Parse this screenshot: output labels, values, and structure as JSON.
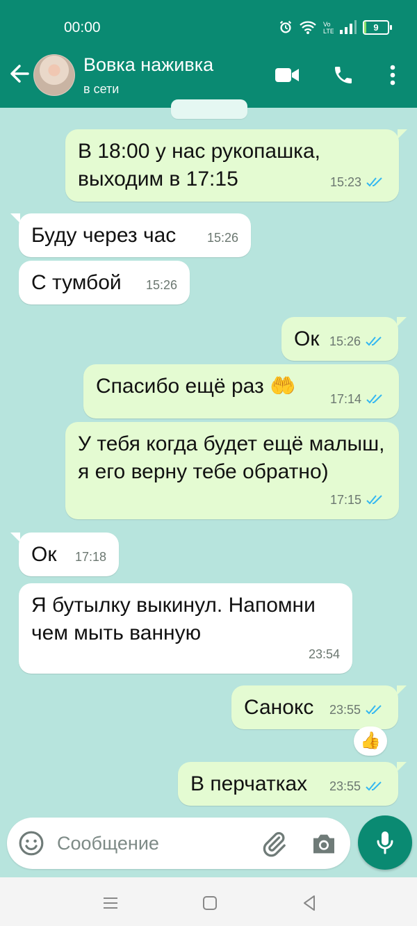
{
  "status_bar": {
    "time": "00:00",
    "battery": "9",
    "battery_fraction": 0.09
  },
  "header": {
    "name": "Вовка наживка",
    "status": "в сети"
  },
  "messages": [
    {
      "dir": "out",
      "text": "В 18:00 у нас рукопашка, выходим в 17:15",
      "time": "15:23",
      "read": true
    },
    {
      "dir": "in",
      "text": "Буду через час",
      "time": "15:26"
    },
    {
      "dir": "in",
      "text": "С тумбой",
      "time": "15:26"
    },
    {
      "dir": "out",
      "text": "Ок",
      "time": "15:26",
      "read": true
    },
    {
      "dir": "out",
      "text": "Спасибо ещё раз 🤲",
      "time": "17:14",
      "read": true
    },
    {
      "dir": "out",
      "text": "У тебя когда будет ещё малыш, я его верну тебе обратно)",
      "time": "17:15",
      "read": true
    },
    {
      "dir": "in",
      "text": "Ок",
      "time": "17:18"
    },
    {
      "dir": "in",
      "text": "Я бутылку выкинул. Напомни чем мыть ванную",
      "time": "23:54"
    },
    {
      "dir": "out",
      "text": "Санокс",
      "time": "23:55",
      "read": true,
      "reaction": "👍"
    },
    {
      "dir": "out",
      "text": "В перчатках",
      "time": "23:55",
      "read": true
    }
  ],
  "composer": {
    "placeholder": "Сообщение"
  },
  "colors": {
    "header": "#0a8a72",
    "chat_bg": "#b7e4dd",
    "outgoing": "#e4fbd2",
    "incoming": "#ffffff",
    "tick": "#34b7f1"
  },
  "icons": [
    "back-arrow-icon",
    "video-call-icon",
    "phone-icon",
    "more-vert-icon",
    "emoji-icon",
    "attach-icon",
    "camera-icon",
    "mic-icon",
    "alarm-icon",
    "wifi-icon",
    "signal-icon",
    "battery-icon"
  ]
}
